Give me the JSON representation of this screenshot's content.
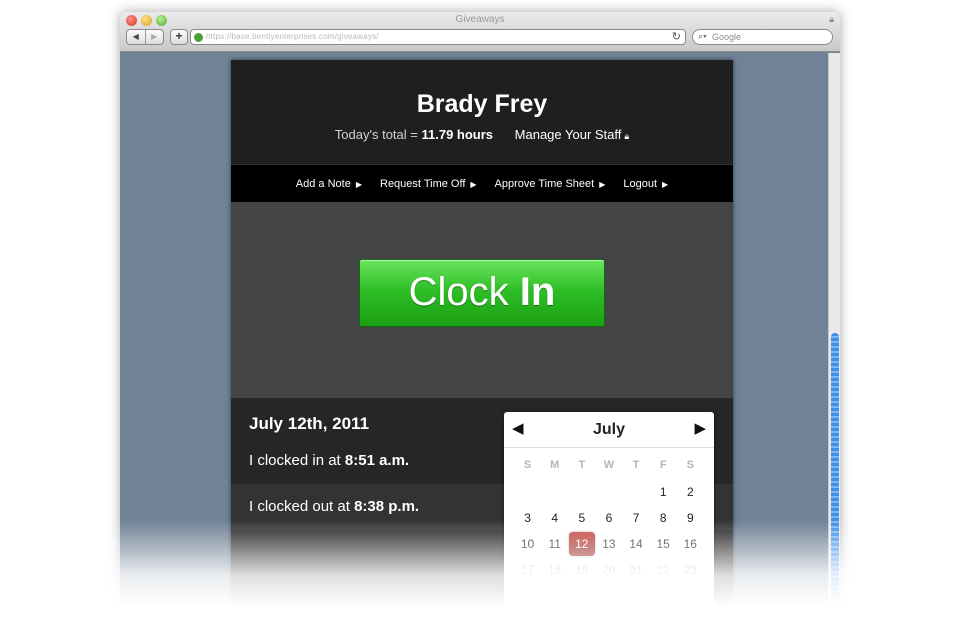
{
  "browser": {
    "window_title": "Giveaways",
    "url": "https://base.bentlyenterprises.com/giveaways/",
    "search_placeholder": "Google",
    "back_label": "◀",
    "forward_label": "▶",
    "add_label": "+",
    "reload_label": "↻"
  },
  "header": {
    "name": "Brady Frey",
    "total_label": "Today's total =",
    "total_value": "11.79 hours",
    "manage_label": "Manage Your Staff"
  },
  "menu": {
    "items": [
      {
        "label": "Add a Note"
      },
      {
        "label": "Request Time Off"
      },
      {
        "label": "Approve Time Sheet"
      },
      {
        "label": "Logout"
      }
    ]
  },
  "clock": {
    "word1": "Clock",
    "word2": "In"
  },
  "entries": {
    "date": "July 12th, 2011",
    "rows": [
      {
        "text": "I clocked in at",
        "time": "8:51 a.m."
      },
      {
        "text": "I clocked out at",
        "time": "8:38 p.m."
      }
    ]
  },
  "calendar": {
    "month": "July",
    "prev": "◀",
    "next": "▶",
    "weekdays": [
      "S",
      "M",
      "T",
      "W",
      "T",
      "F",
      "S"
    ],
    "days": [
      "",
      "",
      "",
      "",
      "",
      "1",
      "2",
      "3",
      "4",
      "5",
      "6",
      "7",
      "8",
      "9",
      "10",
      "11",
      "12",
      "13",
      "14",
      "15",
      "16",
      "17",
      "18",
      "19",
      "20",
      "21",
      "22",
      "23"
    ],
    "selected_day": "12",
    "muted_from_day": "17",
    "colors": {
      "selected": "#a8302b",
      "clock_button": "#2fbf27"
    }
  }
}
